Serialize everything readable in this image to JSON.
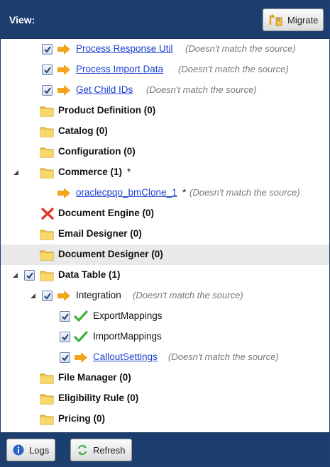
{
  "header": {
    "title": "View:",
    "migrate_label": "Migrate"
  },
  "tree": {
    "items": [
      {
        "label": "Process Response Util",
        "note": "(Doesn't match the source)"
      },
      {
        "label": "Process Import Data",
        "note": "(Doesn't match the source)"
      },
      {
        "label": "Get Child IDs",
        "note": "(Doesn't match the source)"
      },
      {
        "label": "Product Definition (0)"
      },
      {
        "label": "Catalog (0)"
      },
      {
        "label": "Configuration (0)"
      },
      {
        "label": "Commerce (1)",
        "suffix": "*"
      },
      {
        "label": "oraclecpqo_bmClone_1",
        "suffix": "*",
        "note": "(Doesn't match the source)"
      },
      {
        "label": "Document Engine (0)"
      },
      {
        "label": "Email Designer (0)"
      },
      {
        "label": "Document Designer (0)"
      },
      {
        "label": "Data Table (1)"
      },
      {
        "label": "Integration",
        "note": "(Doesn't match the source)"
      },
      {
        "label": "ExportMappings"
      },
      {
        "label": "ImportMappings"
      },
      {
        "label": "CalloutSettings",
        "note": "(Doesn't match the source)"
      },
      {
        "label": "File Manager (0)"
      },
      {
        "label": "Eligibility Rule (0)"
      },
      {
        "label": "Pricing (0)"
      }
    ]
  },
  "footer": {
    "logs_label": "Logs",
    "refresh_label": "Refresh"
  },
  "colors": {
    "header_bg": "#1b3e6e",
    "link": "#1a3fd1",
    "folder": "#f3c64a",
    "arrow": "#f2a51c",
    "check": "#3bb13b",
    "error": "#e03a2a"
  },
  "icons": [
    "migrate-icon",
    "folder-icon",
    "arrow-icon",
    "checkbox-checked-icon",
    "green-check-icon",
    "red-x-icon",
    "info-icon",
    "refresh-icon",
    "expand-triangle-icon"
  ]
}
